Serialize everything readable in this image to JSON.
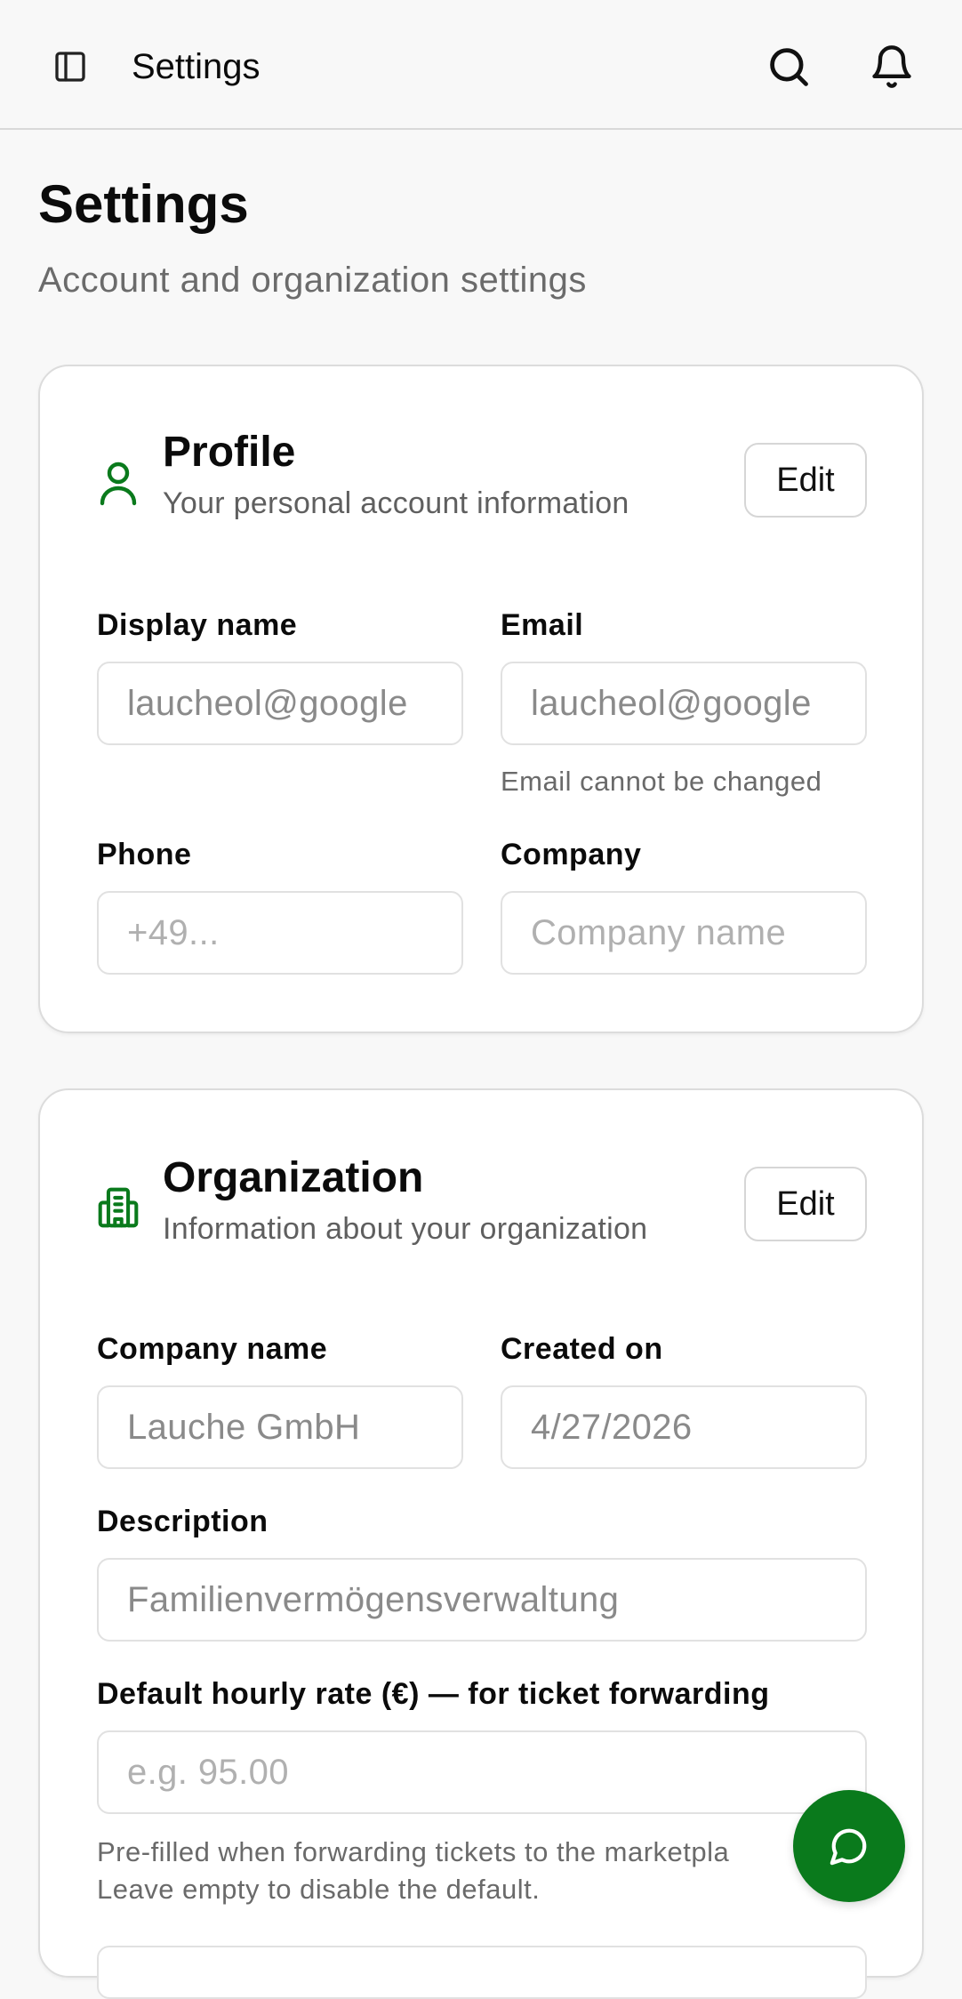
{
  "topbar": {
    "title": "Settings"
  },
  "page": {
    "title": "Settings",
    "subtitle": "Account and organization settings"
  },
  "profile": {
    "title": "Profile",
    "description": "Your personal account information",
    "edit_label": "Edit",
    "display_name_label": "Display name",
    "display_name_value": "laucheol@google",
    "email_label": "Email",
    "email_value": "laucheol@google",
    "email_hint": "Email cannot be changed",
    "phone_label": "Phone",
    "phone_placeholder": "+49...",
    "company_label": "Company",
    "company_placeholder": "Company name"
  },
  "organization": {
    "title": "Organization",
    "description": "Information about your organization",
    "edit_label": "Edit",
    "company_name_label": "Company name",
    "company_name_value": "Lauche GmbH",
    "created_on_label": "Created on",
    "created_on_value": "4/27/2026",
    "description_label": "Description",
    "description_value": "Familienvermögensverwaltung",
    "hourly_rate_label": "Default hourly rate (€) — for ticket forwarding",
    "hourly_rate_placeholder": "e.g. 95.00",
    "hourly_rate_hint_line1": "Pre-filled when forwarding tickets to the marketpla",
    "hourly_rate_hint_line2": "Leave empty to disable the default."
  },
  "icons": {
    "sidebar_toggle": "sidebar-icon",
    "search": "search-icon",
    "notifications": "bell-icon",
    "profile": "user-icon",
    "organization": "building-icon",
    "chat": "chat-bubble-icon"
  },
  "colors": {
    "accent": "#0a7a1c",
    "background": "#f8f8f8",
    "card": "#ffffff"
  }
}
